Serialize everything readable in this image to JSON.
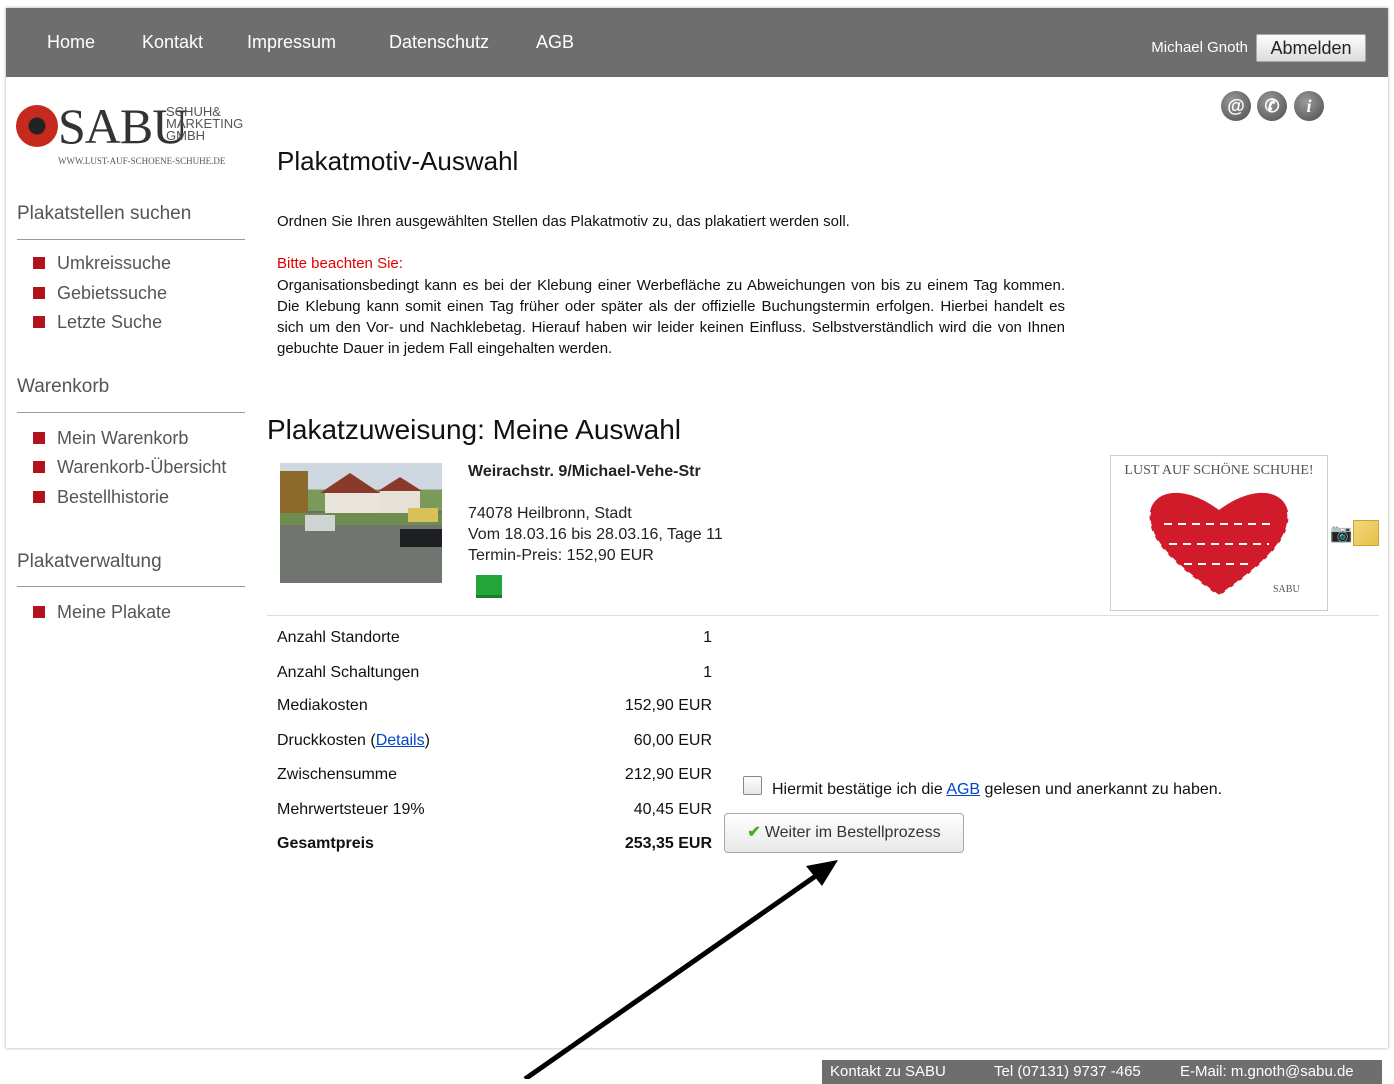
{
  "nav": {
    "items": [
      "Home",
      "Kontakt",
      "Impressum",
      "Datenschutz",
      "AGB"
    ],
    "user": "Michael Gnoth",
    "logout": "Abmelden"
  },
  "logo": {
    "brand": "SABU",
    "sub1": "SCHUH&",
    "sub2": "MARKETING",
    "sub3": "GMBH",
    "url": "WWW.LUST-AUF-SCHOENE-SCHUHE.DE"
  },
  "sidebar": {
    "section1": "Plakatstellen suchen",
    "items1": [
      "Umkreissuche",
      "Gebietssuche",
      "Letzte Suche"
    ],
    "section2": "Warenkorb",
    "items2": [
      "Mein Warenkorb",
      "Warenkorb-Übersicht",
      "Bestellhistorie"
    ],
    "section3": "Plakatverwaltung",
    "items3": [
      "Meine Plakate"
    ]
  },
  "header_icons": [
    "at-icon",
    "phone-icon",
    "info-icon"
  ],
  "main": {
    "title": "Plakatmotiv-Auswahl",
    "intro": "Ordnen Sie Ihren ausgewählten Stellen das Plakatmotiv zu, das plakatiert werden soll.",
    "notice_title": "Bitte beachten Sie:",
    "notice_text": "Organisationsbedingt kann es bei der Klebung einer Werbefläche zu Abweichungen von bis zu einem Tag kommen. Die Klebung kann somit einen Tag früher oder später als der offizielle Buchungstermin erfolgen. Hierbei handelt es sich um den Vor- und Nachklebetag. Hierauf haben wir leider keinen Einfluss. Selbstverständlich wird die von Ihnen gebuchte Dauer in jedem Fall eingehalten werden.",
    "section_title": "Plakatzuweisung: Meine Auswahl"
  },
  "location": {
    "street": "Weirachstr. 9/Michael-Vehe-Str",
    "city": "74078 Heilbronn, Stadt",
    "period": "Vom 18.03.16 bis 28.03.16, Tage 11",
    "price": "Termin-Preis: 152,90 EUR",
    "poster_title": "LUST AUF SCHÖNE SCHUHE!",
    "poster_brand": "SABU"
  },
  "summary": {
    "rows": [
      {
        "label": "Anzahl Standorte",
        "value": "1"
      },
      {
        "label": "Anzahl Schaltungen",
        "value": "1"
      },
      {
        "label": "Mediakosten",
        "value": "152,90 EUR"
      },
      {
        "label": "Druckkosten (",
        "link": "Details",
        "suffix": ")",
        "value": "60,00 EUR"
      },
      {
        "label": "Zwischensumme",
        "value": "212,90 EUR"
      },
      {
        "label": "Mehrwertsteuer 19%",
        "value": "40,45 EUR"
      },
      {
        "label": "Gesamtpreis",
        "value": "253,35 EUR"
      }
    ]
  },
  "confirm": {
    "prefix": "Hiermit bestätige ich die ",
    "link": "AGB",
    "suffix": " gelesen und anerkannt zu haben.",
    "button": "Weiter im Bestellprozess"
  },
  "footer": {
    "contact": "Kontakt zu SABU",
    "phone": "Tel (07131) 9737 -465",
    "email": "E-Mail: m.gnoth@sabu.de"
  },
  "colors": {
    "nav_bg": "#6f6e6f",
    "accent_red": "#b3131d",
    "notice_red": "#e00000",
    "link_blue": "#0044cc"
  }
}
